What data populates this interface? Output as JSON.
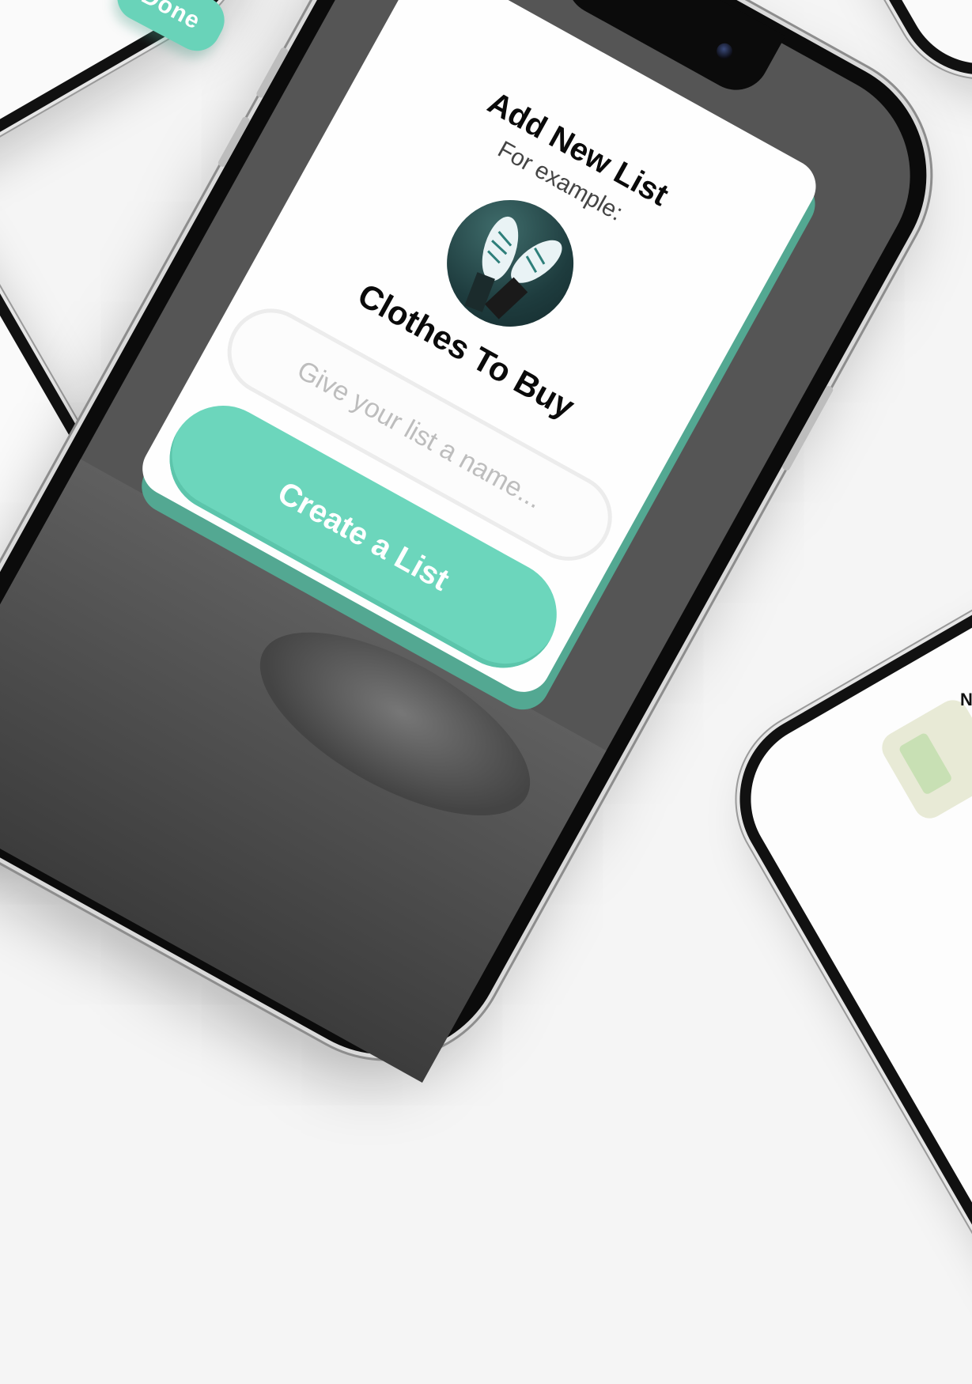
{
  "background_phones": {
    "top_left": {
      "done_label": "Done"
    },
    "bottom_right": {
      "partial_letter": "N"
    }
  },
  "dialog": {
    "title": "Add New List",
    "subtitle": "For example:",
    "example_list_name": "Clothes To Buy",
    "name_input": {
      "placeholder": "Give your list a name...",
      "value": ""
    },
    "create_button_label": "Create a List"
  },
  "colors": {
    "accent": "#6cd6bc",
    "accent_dark": "#53a892",
    "phone_body": "#0b0b0b",
    "page_background": "#f5f5f5"
  }
}
